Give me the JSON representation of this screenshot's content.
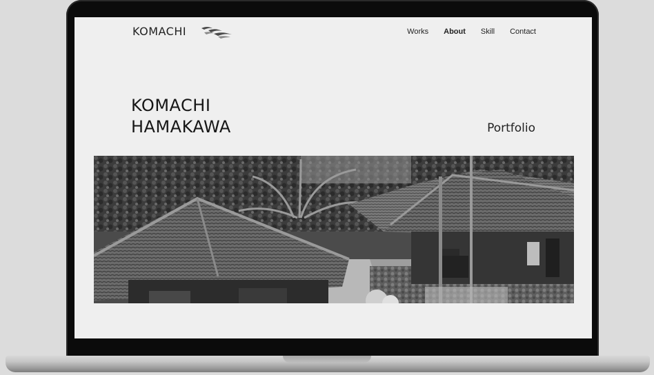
{
  "site": {
    "brand": "KOMACHI",
    "nav": [
      {
        "label": "Works"
      },
      {
        "label": "About"
      },
      {
        "label": "Skill"
      },
      {
        "label": "Contact"
      }
    ],
    "active_nav": "About"
  },
  "hero": {
    "name_line_1": "KOMACHI",
    "name_line_2": "HAMAKAWA",
    "label": "Portfolio"
  },
  "theme": {
    "screen_bg": "#efefef",
    "text": "#1a1a1a",
    "bezel": "#0b0b0b"
  },
  "icons": [
    "wave-logo-icon"
  ],
  "image": {
    "subject": "grayscale photograph of traditional tiled-roof houses with palm trees"
  }
}
